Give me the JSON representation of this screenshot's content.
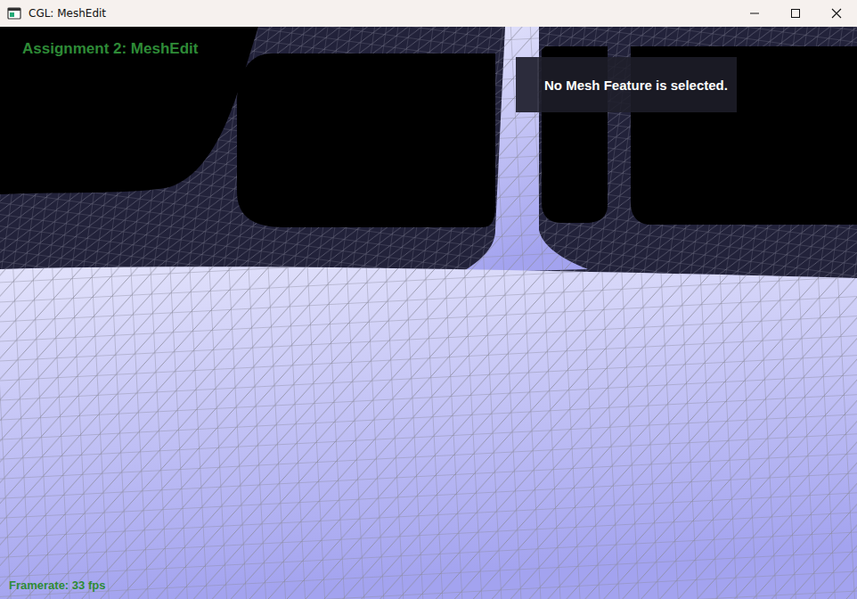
{
  "window": {
    "title": "CGL: MeshEdit"
  },
  "overlay": {
    "heading": "Assignment 2: MeshEdit",
    "selection_info": "No Mesh Feature is selected.",
    "framerate": "Framerate: 33 fps"
  }
}
